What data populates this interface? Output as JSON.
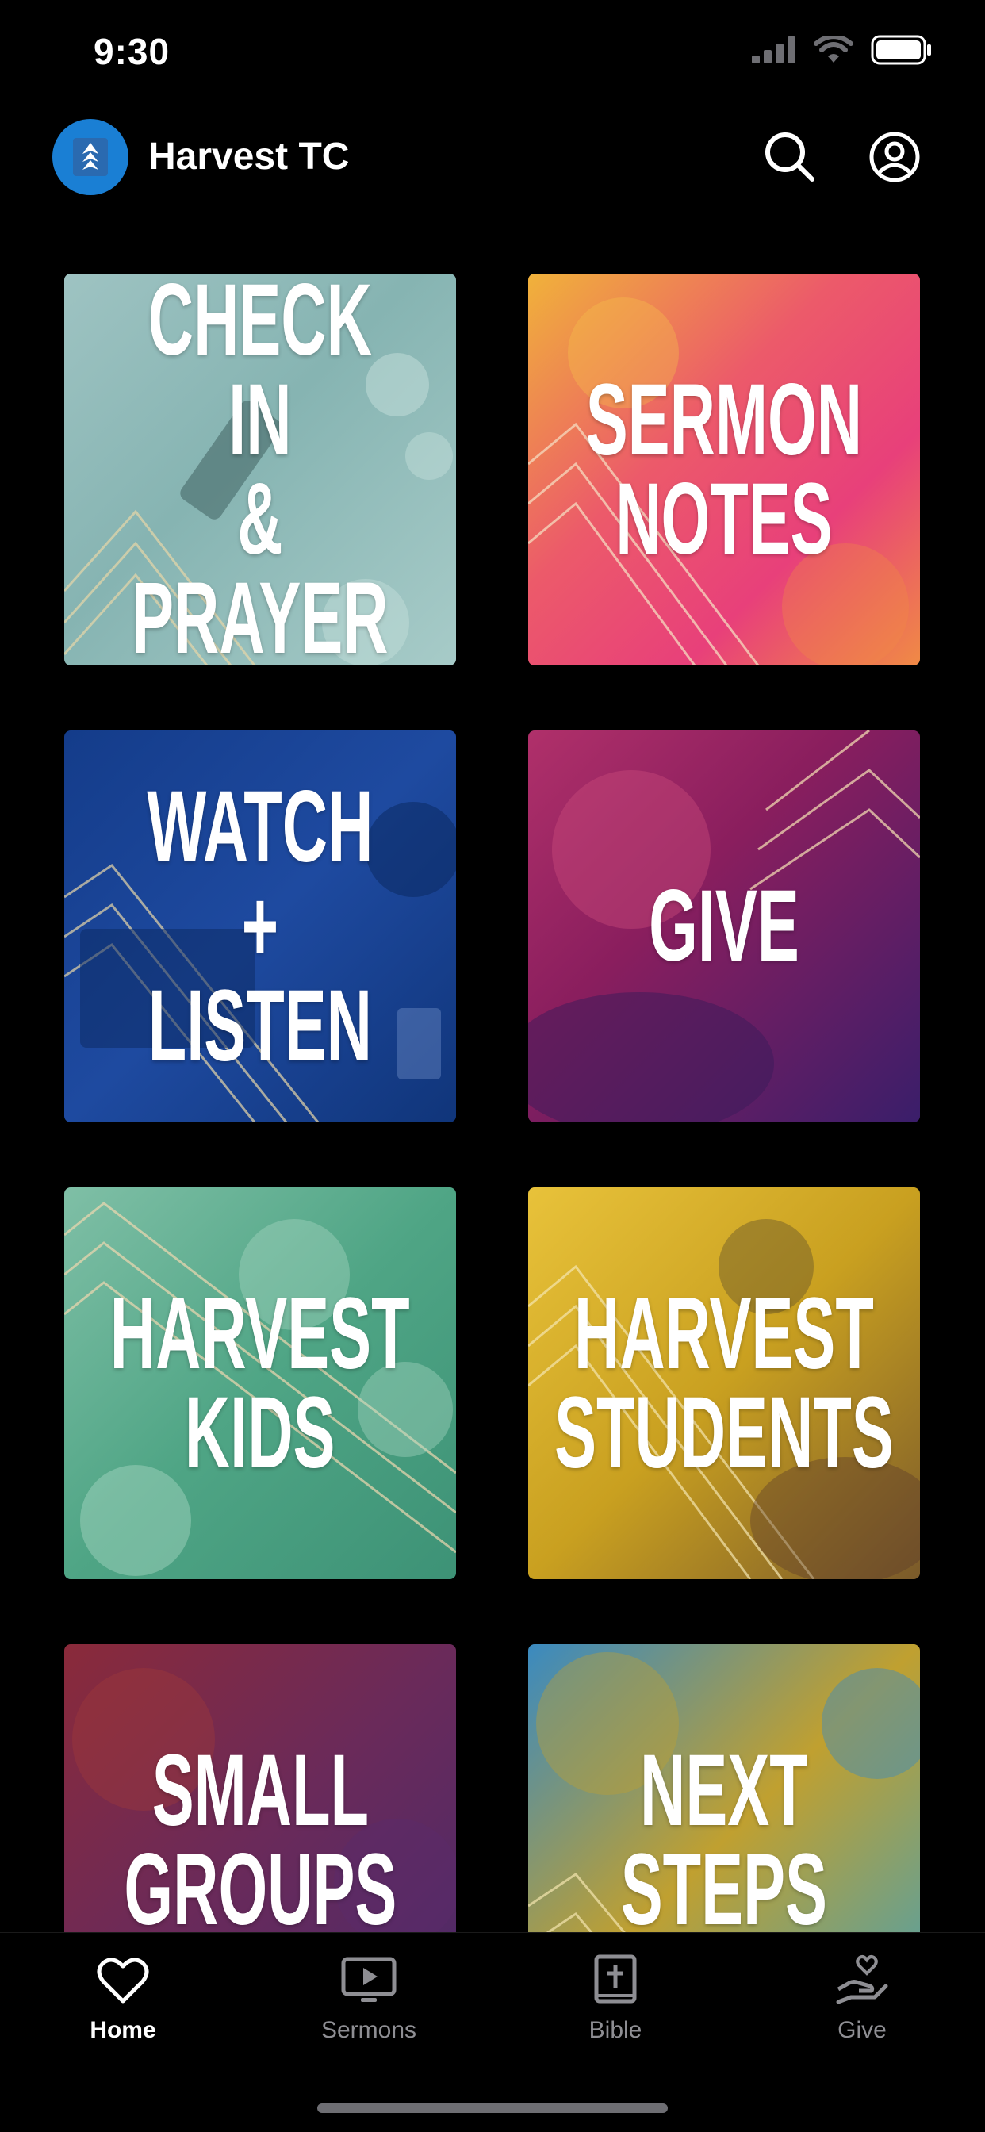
{
  "status_bar": {
    "time": "9:30"
  },
  "header": {
    "title": "Harvest TC",
    "logo_color": "#1a7fd4",
    "icons": [
      "search-icon",
      "account-icon"
    ]
  },
  "tiles": [
    {
      "label": "CHECK IN\n&\nPRAYER"
    },
    {
      "label": "SERMON\nNOTES"
    },
    {
      "label": "WATCH\n+\nLISTEN"
    },
    {
      "label": "GIVE"
    },
    {
      "label": "HARVEST\nKIDS"
    },
    {
      "label": "HARVEST\nSTUDENTS"
    },
    {
      "label": "SMALL\nGROUPS"
    },
    {
      "label": "NEXT\nSTEPS"
    }
  ],
  "tab_bar": {
    "active_color": "#ffffff",
    "inactive_color": "#8e8e93",
    "tabs": [
      {
        "label": "Home",
        "icon": "heart-icon",
        "active": true
      },
      {
        "label": "Sermons",
        "icon": "video-play-icon",
        "active": false
      },
      {
        "label": "Bible",
        "icon": "bible-icon",
        "active": false
      },
      {
        "label": "Give",
        "icon": "give-hand-heart-icon",
        "active": false
      }
    ]
  }
}
